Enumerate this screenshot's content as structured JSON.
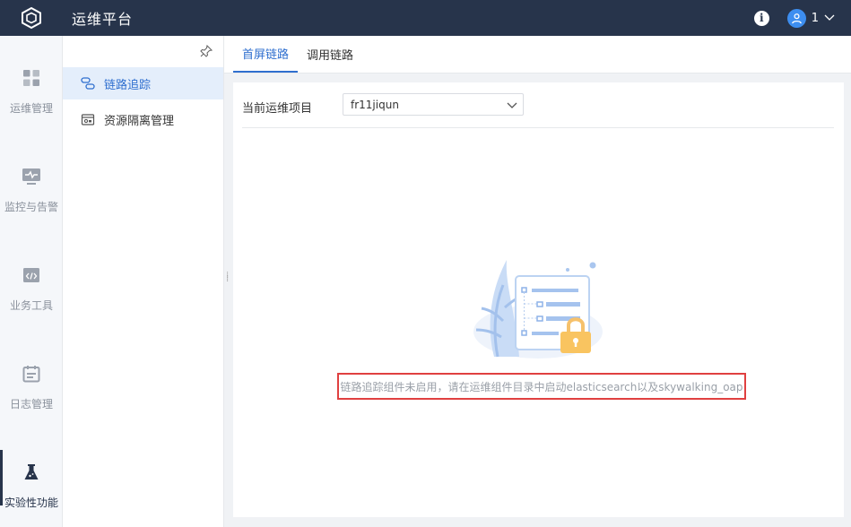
{
  "header": {
    "app_title": "运维平台",
    "user_name": "1",
    "icons": {
      "logo": "cube-logo-icon",
      "info": "info-icon",
      "avatar": "user-avatar-icon",
      "dropdown": "chevron-down-icon"
    }
  },
  "rail": {
    "items": [
      {
        "label": "运维管理",
        "icon": "grid-icon"
      },
      {
        "label": "监控与告警",
        "icon": "monitor-icon"
      },
      {
        "label": "业务工具",
        "icon": "code-icon"
      },
      {
        "label": "日志管理",
        "icon": "calendar-log-icon"
      },
      {
        "label": "实验性功能",
        "icon": "flask-icon",
        "active": true
      }
    ]
  },
  "subnav": {
    "items": [
      {
        "label": "链路追踪",
        "icon": "trace-icon",
        "active": true
      },
      {
        "label": "资源隔离管理",
        "icon": "isolation-icon"
      }
    ]
  },
  "tabs": [
    {
      "label": "首屏链路",
      "active": true
    },
    {
      "label": "调用链路"
    }
  ],
  "main": {
    "project_label": "当前运维项目",
    "project_value": "fr11jiqun",
    "empty_message": "链路追踪组件未启用，请在运维组件目录中启动elasticsearch以及skywalking_oap"
  },
  "colors": {
    "topbar": "#27344b",
    "accent": "#2f6fcf",
    "alert_border": "#e04040"
  }
}
